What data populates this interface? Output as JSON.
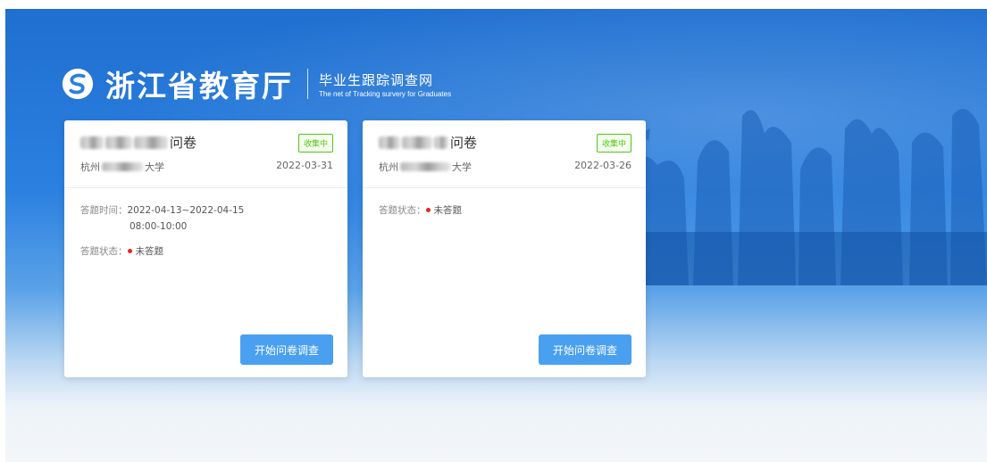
{
  "header": {
    "ministry_name": "浙江省教育厅",
    "site_name": "毕业生跟踪调查网",
    "site_name_en": "The net of Tracking survery for Graduates"
  },
  "cards": [
    {
      "title_suffix": "问卷",
      "badge": "收集中",
      "school_prefix": "杭州",
      "school_suffix": "大学",
      "date": "2022-03-31",
      "time_label": "答题时间：",
      "time_value": "2022-04-13~2022-04-15",
      "time_value2": "08:00-10:00",
      "status_label": "答题状态：",
      "status_value": "未答题",
      "button": "开始问卷调查"
    },
    {
      "title_suffix": "问卷",
      "badge": "收集中",
      "school_prefix": "杭州",
      "school_suffix": "大学",
      "date": "2022-03-26",
      "status_label": "答题状态：",
      "status_value": "未答题",
      "button": "开始问卷调查"
    }
  ],
  "colors": {
    "brand_blue": "#2b80e0",
    "badge_green": "#52c41a",
    "button_blue": "#4aa0f0",
    "status_dot": "#e22222"
  },
  "icons": {
    "logo": "ministry-logo-icon"
  }
}
